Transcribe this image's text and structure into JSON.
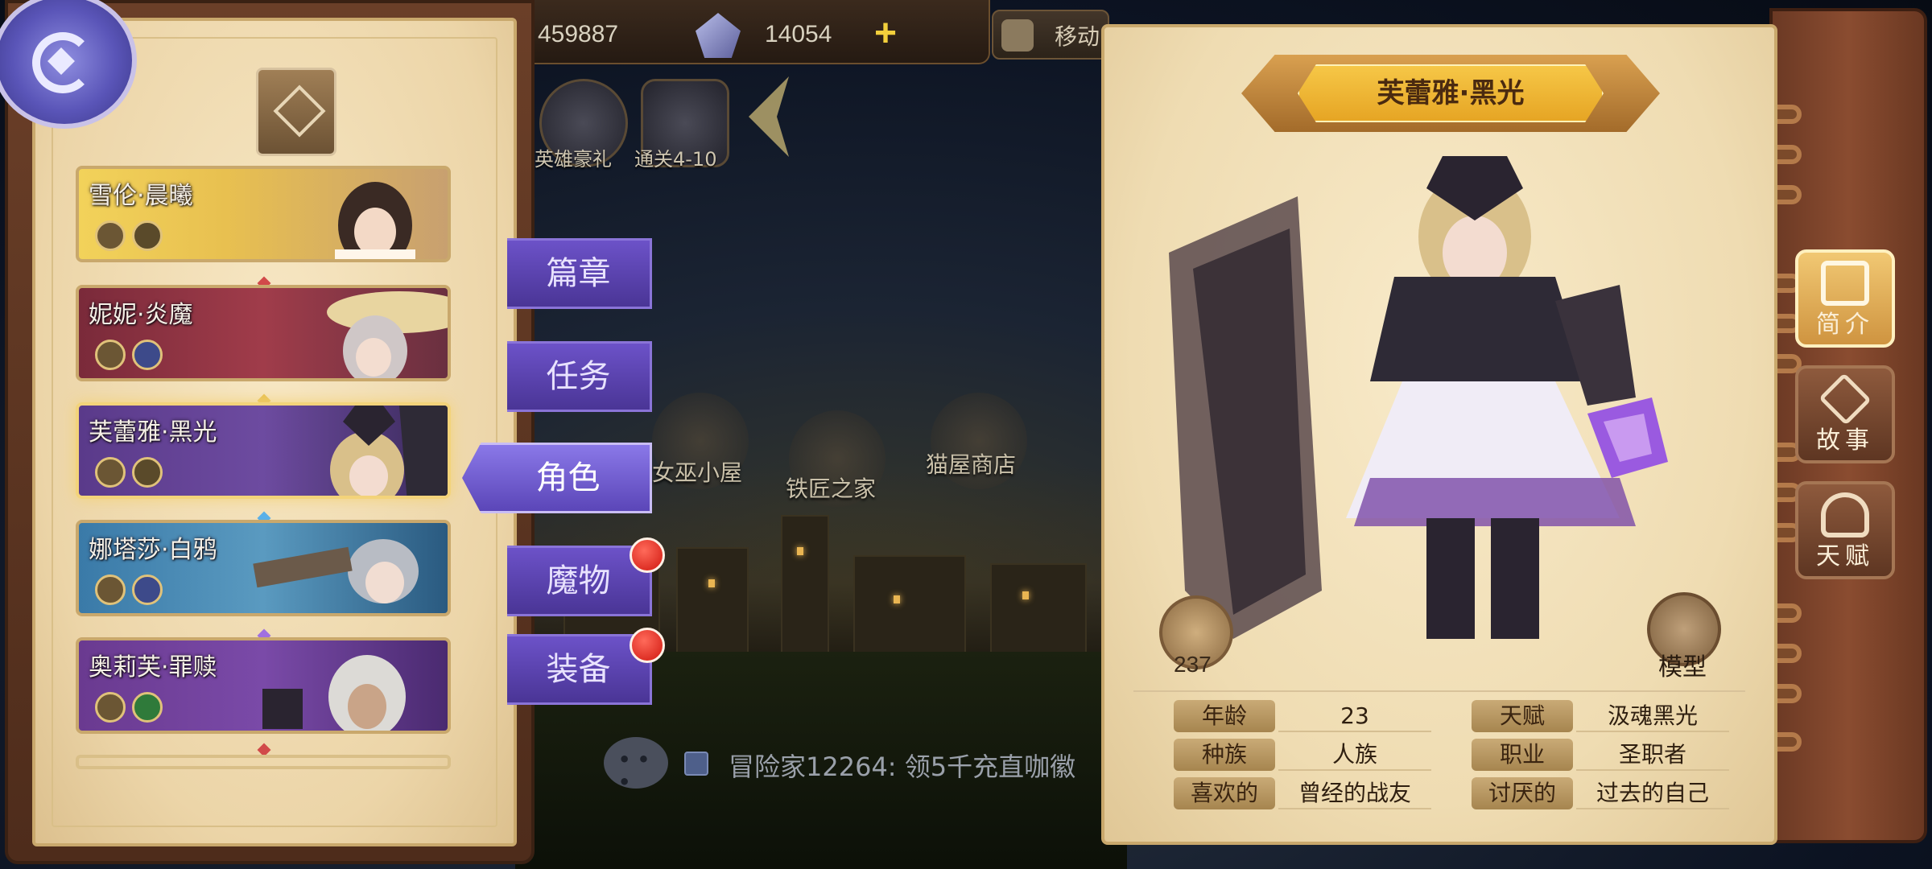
{
  "resources": {
    "gold_value": "459887",
    "gem_value": "14054",
    "move_label": "移动"
  },
  "events": [
    {
      "label": "英雄豪礼"
    },
    {
      "label": "通关4-10"
    }
  ],
  "buildings": [
    {
      "label": "女巫小屋"
    },
    {
      "label": "铁匠之家"
    },
    {
      "label": "猫屋商店"
    }
  ],
  "chat": {
    "message": "冒险家12264: 领5千充直咖徽"
  },
  "hero_list": [
    {
      "name": "雪伦·晨曦"
    },
    {
      "name": "妮妮·炎魔"
    },
    {
      "name": "芙蕾雅·黑光",
      "selected": true
    },
    {
      "name": "娜塔莎·白鸦"
    },
    {
      "name": "奥莉芙·罪赎"
    }
  ],
  "tabs": [
    {
      "label": "篇章"
    },
    {
      "label": "任务"
    },
    {
      "label": "角色",
      "active": true
    },
    {
      "label": "魔物",
      "notify": true
    },
    {
      "label": "装备",
      "notify": true
    }
  ],
  "detail": {
    "title": "芙蕾雅·黑光",
    "likes": "237",
    "model_label": "模型",
    "info": [
      {
        "label": "年龄",
        "value": "23",
        "label2": "天赋",
        "value2": "汲魂黑光"
      },
      {
        "label": "种族",
        "value": "人族",
        "label2": "职业",
        "value2": "圣职者"
      },
      {
        "label": "喜欢的",
        "value": "曾经的战友",
        "label2": "讨厌的",
        "value2": "过去的自己"
      }
    ]
  },
  "side_tabs": [
    {
      "label": "简介",
      "active": true
    },
    {
      "label": "故事"
    },
    {
      "label": "天赋"
    }
  ],
  "colors": {
    "tab_purple": "#5b46b8",
    "title_gold": "#f6c747",
    "notify_red": "#d0170f"
  }
}
